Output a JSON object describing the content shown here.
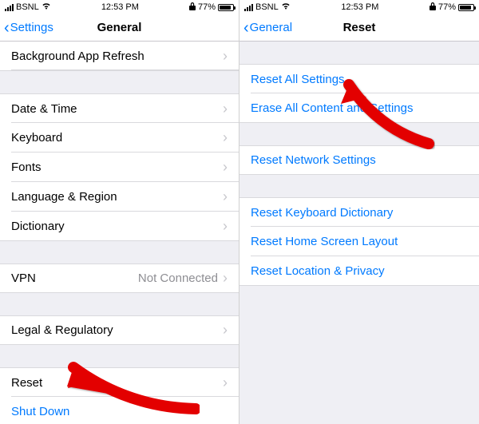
{
  "status": {
    "carrier": "BSNL",
    "time": "12:53 PM",
    "battery_pct": "77%"
  },
  "left": {
    "back_label": "Settings",
    "title": "General",
    "rows": {
      "background_refresh": "Background App Refresh",
      "date_time": "Date & Time",
      "keyboard": "Keyboard",
      "fonts": "Fonts",
      "lang_region": "Language & Region",
      "dictionary": "Dictionary",
      "vpn": "VPN",
      "vpn_status": "Not Connected",
      "legal": "Legal & Regulatory",
      "reset": "Reset",
      "shutdown": "Shut Down"
    }
  },
  "right": {
    "back_label": "General",
    "title": "Reset",
    "rows": {
      "reset_all": "Reset All Settings",
      "erase_all": "Erase All Content and Settings",
      "reset_network": "Reset Network Settings",
      "reset_keyboard": "Reset Keyboard Dictionary",
      "reset_home": "Reset Home Screen Layout",
      "reset_location": "Reset Location & Privacy"
    }
  },
  "colors": {
    "accent": "#007aff",
    "row_bg": "#ffffff",
    "page_bg": "#efeff4",
    "detail": "#8e8e93"
  }
}
